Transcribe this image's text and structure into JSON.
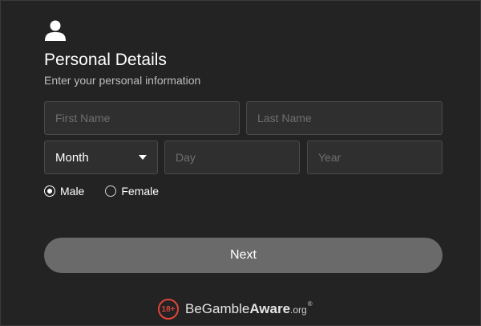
{
  "header": {
    "icon": "user-icon",
    "title": "Personal Details",
    "subtitle": "Enter your personal information"
  },
  "form": {
    "first_name": {
      "value": "",
      "placeholder": "First Name"
    },
    "last_name": {
      "value": "",
      "placeholder": "Last Name"
    },
    "dob": {
      "month": {
        "selected": "Month"
      },
      "day": {
        "value": "",
        "placeholder": "Day"
      },
      "year": {
        "value": "",
        "placeholder": "Year"
      }
    },
    "gender": {
      "options": [
        {
          "label": "Male",
          "checked": true
        },
        {
          "label": "Female",
          "checked": false
        }
      ]
    }
  },
  "actions": {
    "next_label": "Next"
  },
  "footer": {
    "age_badge": "18+",
    "brand_part1": "Be",
    "brand_part2": "Gamble",
    "brand_part3": "Aware",
    "brand_suffix": ".org",
    "registered": "®"
  },
  "colors": {
    "background": "#232323",
    "field_bg": "#2f2f2f",
    "button_bg": "#6a6a6a",
    "badge": "#e0443c"
  }
}
